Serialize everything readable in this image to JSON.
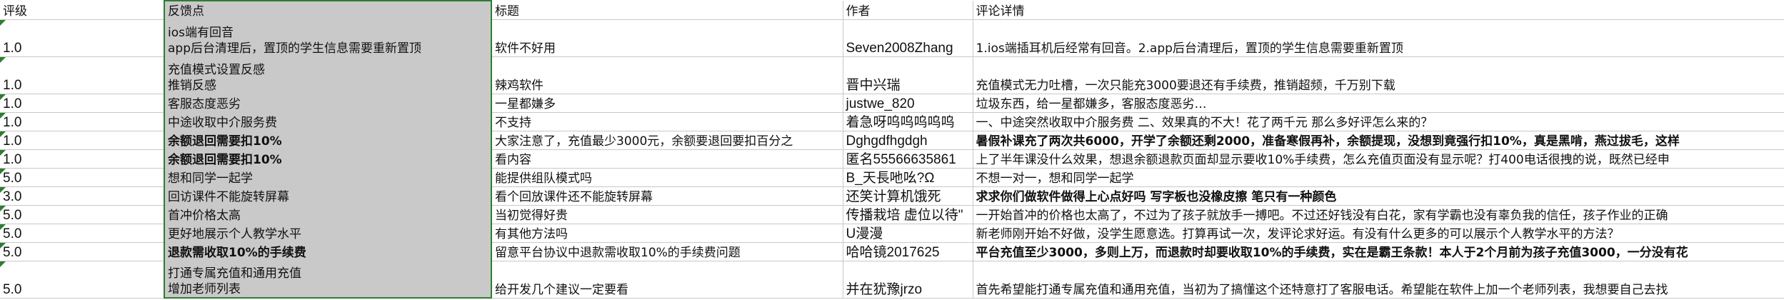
{
  "sheet": {
    "columns": [
      {
        "key": "grade",
        "label": "评级"
      },
      {
        "key": "feedback",
        "label": "反馈点"
      },
      {
        "key": "title",
        "label": "标题"
      },
      {
        "key": "author",
        "label": "作者"
      },
      {
        "key": "detail",
        "label": "评论详情"
      }
    ],
    "rows": [
      {
        "grade": "1.0",
        "feedback_lines": [
          "ios端有回音",
          "app后台清理后，置顶的学生信息需要重新置顶"
        ],
        "title": "软件不好用",
        "author": "Seven2008Zhang",
        "detail": "1.ios端插耳机后经常有回音。2.app后台清理后，置顶的学生信息需要重新置顶",
        "bold_feedback": false,
        "bold_detail": false
      },
      {
        "grade": "1.0",
        "feedback_lines": [
          "充值模式设置反感",
          "推销反感"
        ],
        "title": "辣鸡软件",
        "author": "晋中兴瑞",
        "detail": "充值模式无力吐槽，一次只能充3000要退还有手续费，推销超频，千万别下载",
        "bold_feedback": false,
        "bold_detail": false
      },
      {
        "grade": "1.0",
        "feedback_lines": [
          "客服态度恶劣"
        ],
        "title": "一星都嫌多",
        "author": "justwe_820",
        "detail": "垃圾东西，给一星都嫌多，客服态度恶劣…",
        "bold_feedback": false,
        "bold_detail": false
      },
      {
        "grade": "1.0",
        "feedback_lines": [
          "中途收取中介服务费"
        ],
        "title": "不支持",
        "author": "着急呀呜呜呜呜呜",
        "detail": "一、中途突然收取中介服务费 二、效果真的不大！花了两千元 那么多好评怎么来的？",
        "bold_feedback": false,
        "bold_detail": false
      },
      {
        "grade": "1.0",
        "feedback_lines": [
          "余额退回需要扣10%"
        ],
        "title": "大家注意了，充值最少3000元，余额要退回要扣百分之",
        "author": "Dghgdfhgdgh",
        "detail": "暑假补课充了两次共6000，开学了余额还剩2000，准备寒假再补，余额提现，没想到竟强行扣10%，真是黑啃，燕过拔毛，这样",
        "bold_feedback": true,
        "bold_detail": true
      },
      {
        "grade": "1.0",
        "feedback_lines": [
          "余额退回需要扣10%"
        ],
        "title": "看内容",
        "author": "匿名55566635861",
        "detail": "上了半年课没什么效果，想退余额退款页面却显示要收10%手续费，怎么充值页面没有显示呢？打400电话很拽的说，既然已经申",
        "bold_feedback": true,
        "bold_detail": false
      },
      {
        "grade": "5.0",
        "feedback_lines": [
          "想和同学一起学"
        ],
        "title": "能提供组队模式吗",
        "author": "B_天長吔吆?Ω",
        "detail": "不想一对一，想和同学一起学",
        "bold_feedback": false,
        "bold_detail": false
      },
      {
        "grade": "3.0",
        "feedback_lines": [
          "回访课件不能旋转屏幕"
        ],
        "title": "看个回放课件还不能旋转屏幕",
        "author": "还笑计算机饿死",
        "detail": "求求你们做软件做得上心点好吗 写字板也没橡皮擦 笔只有一种颜色",
        "bold_feedback": false,
        "bold_detail": true
      },
      {
        "grade": "5.0",
        "feedback_lines": [
          "首冲价格太高"
        ],
        "title": "当初觉得好贵",
        "author": "传播栽培 虚位以待\"",
        "detail": "一开始首冲的价格也太高了，不过为了孩子就放手一搏吧。不过还好钱没有白花，家有学霸也没有辜负我的信任，孩子作业的正确",
        "bold_feedback": false,
        "bold_detail": false
      },
      {
        "grade": "5.0",
        "feedback_lines": [
          "更好地展示个人教学水平"
        ],
        "title": "有其他方法吗",
        "author": "U漫漫",
        "detail": "新老师刚开始不好做，没学生愿意选。打算再试一次，发评论求好运。有没有什么更多的可以展示个人教学水平的方法？",
        "bold_feedback": false,
        "bold_detail": false
      },
      {
        "grade": "5.0",
        "feedback_lines": [
          "退款需收取10%的手续费"
        ],
        "title": "留意平台协议中退款需收取10%的手续费问题",
        "author": "哈哈镜2017625",
        "detail": "平台充值至少3000，多则上万，而退款时却要收取10%的手续费，实在是霸王条款！本人于2个月前为孩子充值3000，一分没有花",
        "bold_feedback": true,
        "bold_detail": true
      },
      {
        "grade": "5.0",
        "feedback_lines": [
          "打通专属充值和通用充值",
          "增加老师列表"
        ],
        "title": "给开发几个建议一定要看",
        "author": "并在犹豫jrzo",
        "detail": "首先希望能打通专属充值和通用充值，当初为了搞懂这个还特意打了客服电话。希望能在软件上加一个老师列表，我想要自己去找",
        "bold_feedback": false,
        "bold_detail": false
      }
    ]
  }
}
